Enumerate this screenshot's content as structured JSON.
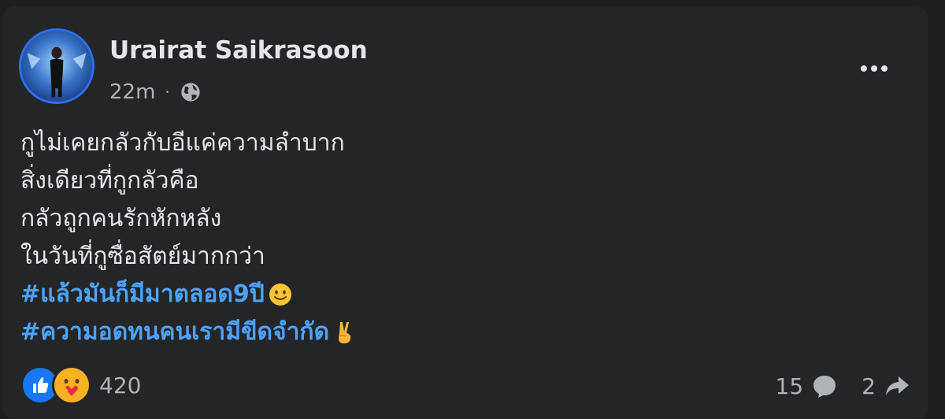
{
  "post": {
    "author": "Urairat Saikrasoon",
    "time": "22m",
    "separator": "·",
    "privacy_icon": "globe-icon",
    "more_icon": "more-options-icon",
    "lines": [
      "กูไม่เคยกลัวกับอีแค่ความลำบาก",
      "สิ่งเดียวที่กูกลัวคือ",
      "กลัวถูกคนรักหักหลัง",
      "ในวันที่กูซื่อสัตย์มากกว่า"
    ],
    "hashtags": [
      "#แล้วมันก็มีมาตลอด9ปี",
      "#ความอดทนคนเรามีขีดจำกัด"
    ],
    "hashtag_emojis": [
      "slightly-smiling-emoji",
      "victory-hand-emoji"
    ],
    "reaction_icons": [
      "like-reaction-icon",
      "care-reaction-icon"
    ],
    "reaction_count": "420",
    "comment_count": "15",
    "comment_icon": "comment-icon",
    "share_count": "2",
    "share_icon": "share-icon"
  },
  "colors": {
    "background": "#242526",
    "text": "#e4e6eb",
    "secondary_text": "#b0b3b8",
    "hashtag": "#4da3ff",
    "like_blue": "#1877f2"
  }
}
